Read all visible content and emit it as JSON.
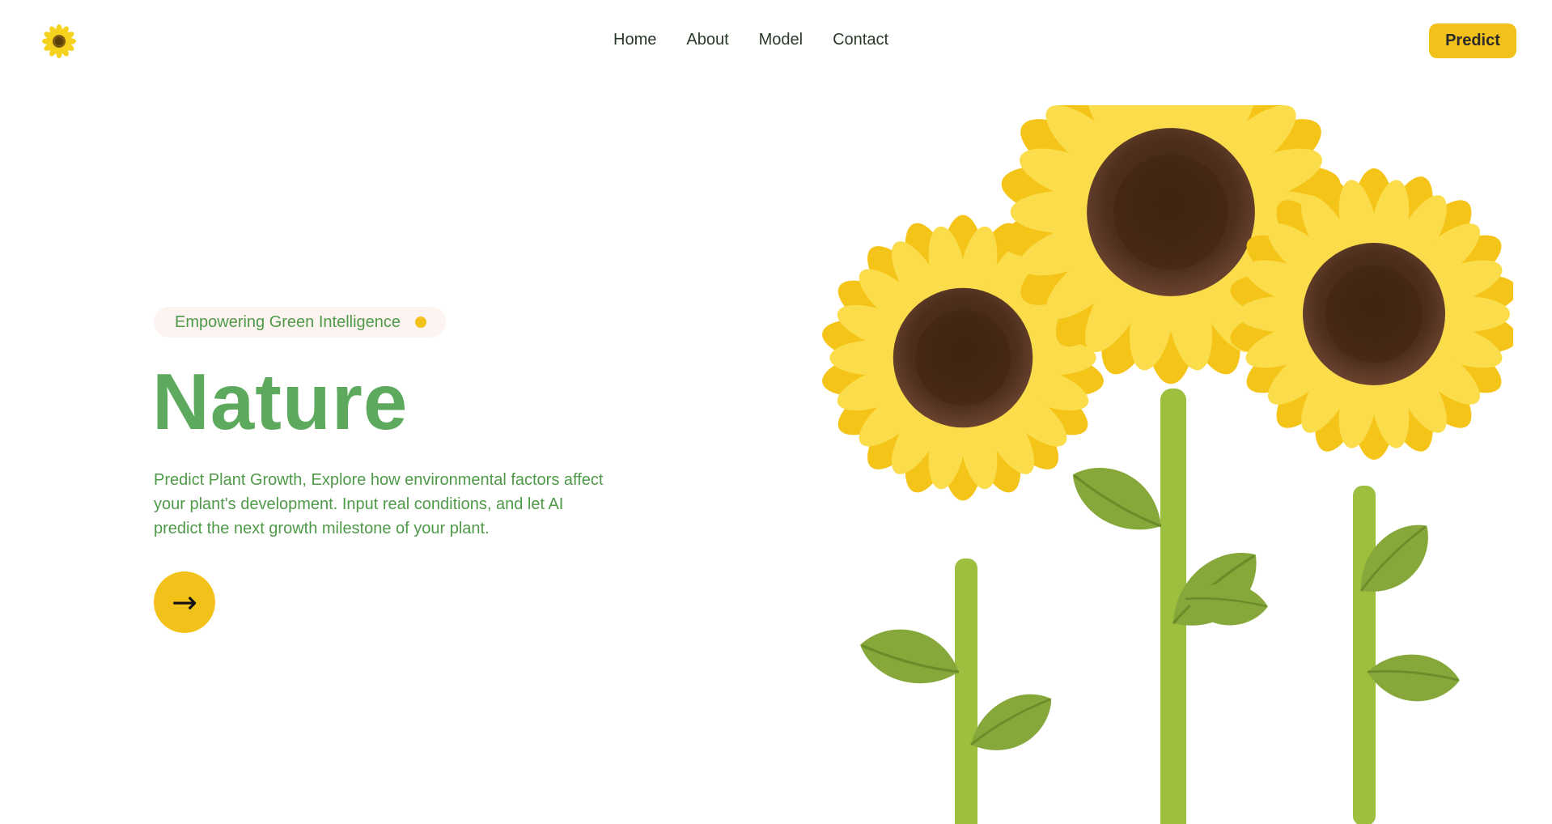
{
  "nav": {
    "items": [
      {
        "label": "Home"
      },
      {
        "label": "About"
      },
      {
        "label": "Model"
      },
      {
        "label": "Contact"
      }
    ],
    "predict_label": "Predict"
  },
  "hero": {
    "badge": "Empowering Green Intelligence",
    "title": "Nature",
    "description": "Predict Plant Growth, Explore how environmental factors affect your plant's development. Input real conditions, and let AI predict the next growth milestone of your plant.",
    "arrow": "→"
  },
  "colors": {
    "accent_yellow": "#f3c21a",
    "green": "#5daa5f",
    "text_green": "#4f9a48"
  },
  "icons": {
    "logo": "sunflower-icon",
    "illustration": "sunflowers-illustration"
  }
}
